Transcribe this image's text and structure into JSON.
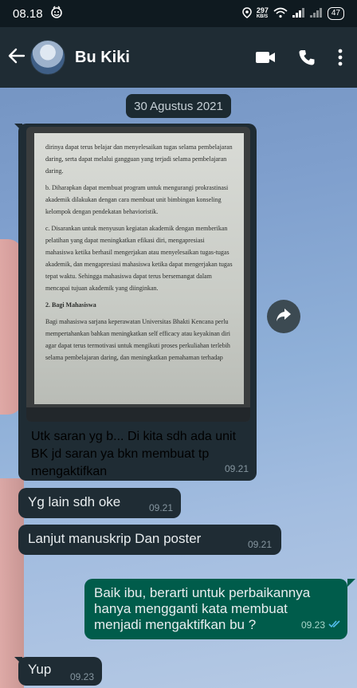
{
  "status_bar": {
    "time": "08.18",
    "net_speed_value": "297",
    "net_speed_unit": "KB/S",
    "battery": "47"
  },
  "header": {
    "contact_name": "Bu Kiki"
  },
  "chat": {
    "date_chip": "30 Agustus 2021",
    "media_message": {
      "caption": "Utk saran yg b... Di kita sdh ada unit BK jd saran ya bkn membuat tp mengaktifkan",
      "time": "09.21",
      "doc_lines": [
        "dirinya dapat terus belajar dan menyelesaikan tugas selama pembelajaran daring, serta dapat melalui gangguan yang terjadi selama pembelajaran daring.",
        "b. Diharapkan dapat membuat program untuk mengurangi prokrastinasi akademik dilakukan dengan cara membuat unit bimbingan konseling kelompok dengan pendekatan behavioristik.",
        "c. Disarankan untuk menyusun kegiatan akademik dengan memberikan pelatihan yang dapat meningkatkan efikasi diri, mengapresiasi mahasiswa ketika berhasil mengerjakan atau menyelesaikan tugas-tugas akademik, dan mengapresiasi mahasiswa ketika dapat mengerjakan tugas tepat waktu. Sehingga mahasiswa dapat terus bersemangat dalam mencapai tujuan akademik yang diinginkan.",
        "2. Bagi Mahasiswa",
        "Bagi mahasiswa sarjana keperawatan Universitas Bhakti Kencana perlu mempertahankan bahkan meningkatkan self efficacy atau keyakinan diri agar dapat terus termotivasi untuk mengikuti proses perkuliahan terlebih selama pembelajaran daring, dan meningkatkan pemahaman terhadap"
      ]
    },
    "messages": [
      {
        "text": "Yg lain sdh oke",
        "time": "09.21"
      },
      {
        "text": "Lanjut manuskrip Dan poster",
        "time": "09.21"
      },
      {
        "text": "Baik ibu, berarti untuk perbaikannya hanya mengganti kata membuat menjadi mengaktifkan bu ?",
        "time": "09.23"
      },
      {
        "text": "Yup",
        "time": "09.23"
      }
    ]
  }
}
